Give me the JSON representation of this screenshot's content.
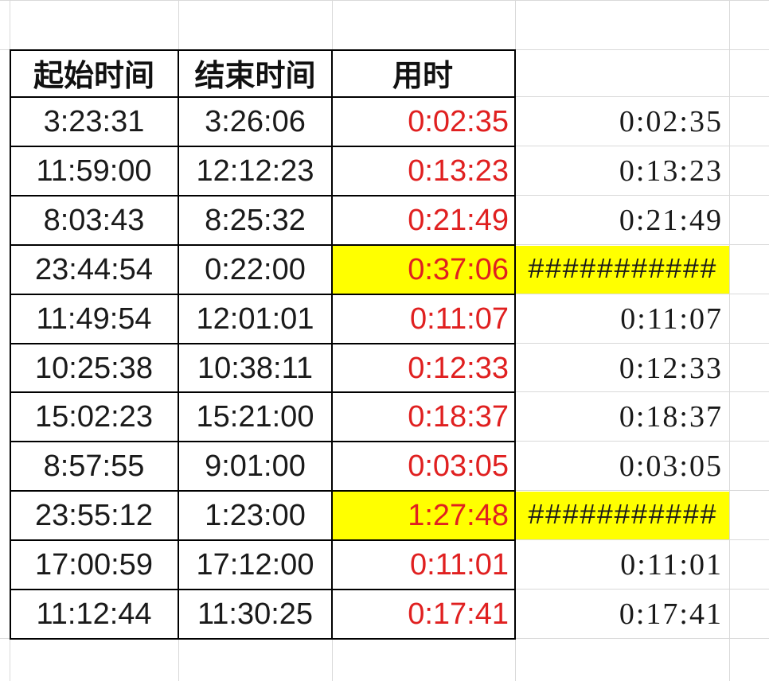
{
  "headers": {
    "start": "起始时间",
    "end": "结束时间",
    "duration": "用时"
  },
  "rows": [
    {
      "start": "3:23:31",
      "end": "3:26:06",
      "duration": "0:02:35",
      "numeric": "0:02:35",
      "highlight": false
    },
    {
      "start": "11:59:00",
      "end": "12:12:23",
      "duration": "0:13:23",
      "numeric": "0:13:23",
      "highlight": false
    },
    {
      "start": "8:03:43",
      "end": "8:25:32",
      "duration": "0:21:49",
      "numeric": "0:21:49",
      "highlight": false
    },
    {
      "start": "23:44:54",
      "end": "0:22:00",
      "duration": "0:37:06",
      "numeric": "###########",
      "highlight": true
    },
    {
      "start": "11:49:54",
      "end": "12:01:01",
      "duration": "0:11:07",
      "numeric": "0:11:07",
      "highlight": false
    },
    {
      "start": "10:25:38",
      "end": "10:38:11",
      "duration": "0:12:33",
      "numeric": "0:12:33",
      "highlight": false
    },
    {
      "start": "15:02:23",
      "end": "15:21:00",
      "duration": "0:18:37",
      "numeric": "0:18:37",
      "highlight": false
    },
    {
      "start": "8:57:55",
      "end": "9:01:00",
      "duration": "0:03:05",
      "numeric": "0:03:05",
      "highlight": false
    },
    {
      "start": "23:55:12",
      "end": "1:23:00",
      "duration": "1:27:48",
      "numeric": "###########",
      "highlight": true
    },
    {
      "start": "17:00:59",
      "end": "17:12:00",
      "duration": "0:11:01",
      "numeric": "0:11:01",
      "highlight": false
    },
    {
      "start": "11:12:44",
      "end": "11:30:25",
      "duration": "0:17:41",
      "numeric": "0:17:41",
      "highlight": false
    }
  ],
  "colors": {
    "duration_text": "#e02020",
    "highlight_fill": "#ffff00",
    "gridline": "#d9d9d9",
    "border": "#000000"
  }
}
